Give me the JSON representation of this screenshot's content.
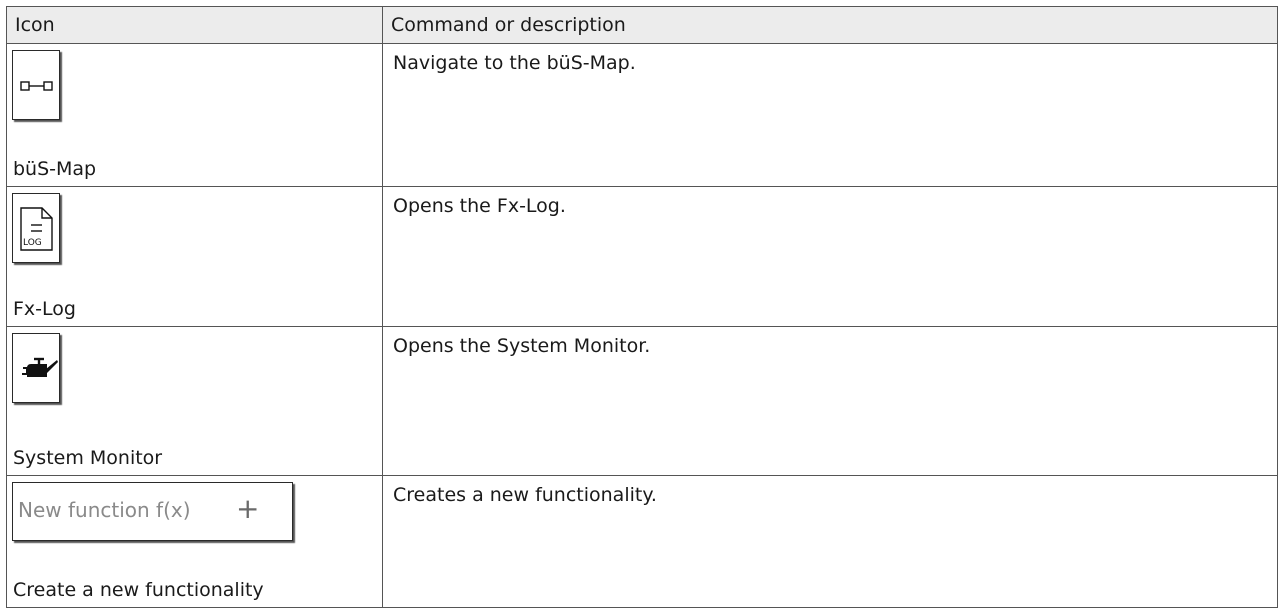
{
  "table": {
    "headers": {
      "icon": "Icon",
      "command": "Command or description"
    },
    "rows": [
      {
        "icon_name": "bus-map-icon",
        "caption": "büS-Map",
        "description": "Navigate to the büS-Map."
      },
      {
        "icon_name": "log-document-icon",
        "icon_text": "LOG",
        "caption": "Fx-Log",
        "description": "Opens the Fx-Log."
      },
      {
        "icon_name": "oil-can-icon",
        "caption": "System Monitor",
        "description": "Opens the System Monitor."
      },
      {
        "icon_name": "plus-icon",
        "button_label": "New function f(x)",
        "button_symbol": "+",
        "caption": "Create a new functionality",
        "description": "Creates a new functionality."
      }
    ]
  }
}
